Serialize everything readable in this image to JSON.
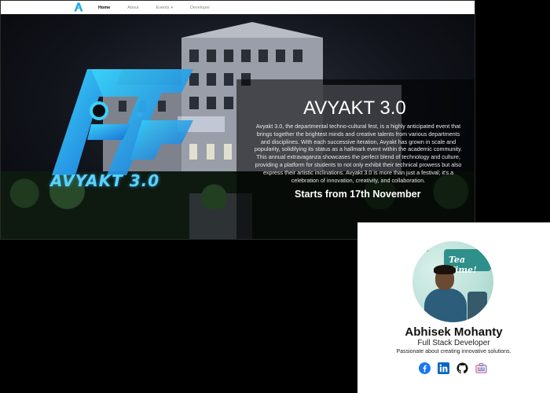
{
  "navbar": {
    "logo_icon": "av-logo-icon",
    "links": [
      {
        "label": "Home",
        "active": true
      },
      {
        "label": "About",
        "active": false
      },
      {
        "label": "Events",
        "active": false,
        "dropdown": true
      },
      {
        "label": "Developer",
        "active": false
      }
    ]
  },
  "hero": {
    "logo_text": "AVYAKT 3.0",
    "title": "AVYAKT 3.0",
    "description": "Avyakt 3.0, the departmental techno-cultural fest, is a highly anticipated event that brings together the brightest minds and creative talents from various departments and disciplines. With each successive iteration, Avyakt has grown in scale and popularity, solidifying its status as a hallmark event within the academic community. This annual extravaganza showcases the perfect blend of technology and culture, providing a platform for students to not only exhibit their technical prowess but also express their artistic inclinations. Avyakt 3.0 is more than just a festival; it's a celebration of innovation, creativity, and collaboration.",
    "start": "Starts from 17th November"
  },
  "profile": {
    "photo_banner": "Tea Time!",
    "photo_small": "It's",
    "name": "Abhisek Mohanty",
    "role": "Full Stack Developer",
    "tagline": "Passionate about creating innovative solutions.",
    "socials": [
      "facebook-icon",
      "linkedin-icon",
      "github-icon",
      "portfolio-icon"
    ]
  },
  "colors": {
    "accent": "#5fd2f5",
    "facebook": "#1877f2",
    "linkedin": "#0a66c2",
    "portfolio": "#9b59b6"
  }
}
